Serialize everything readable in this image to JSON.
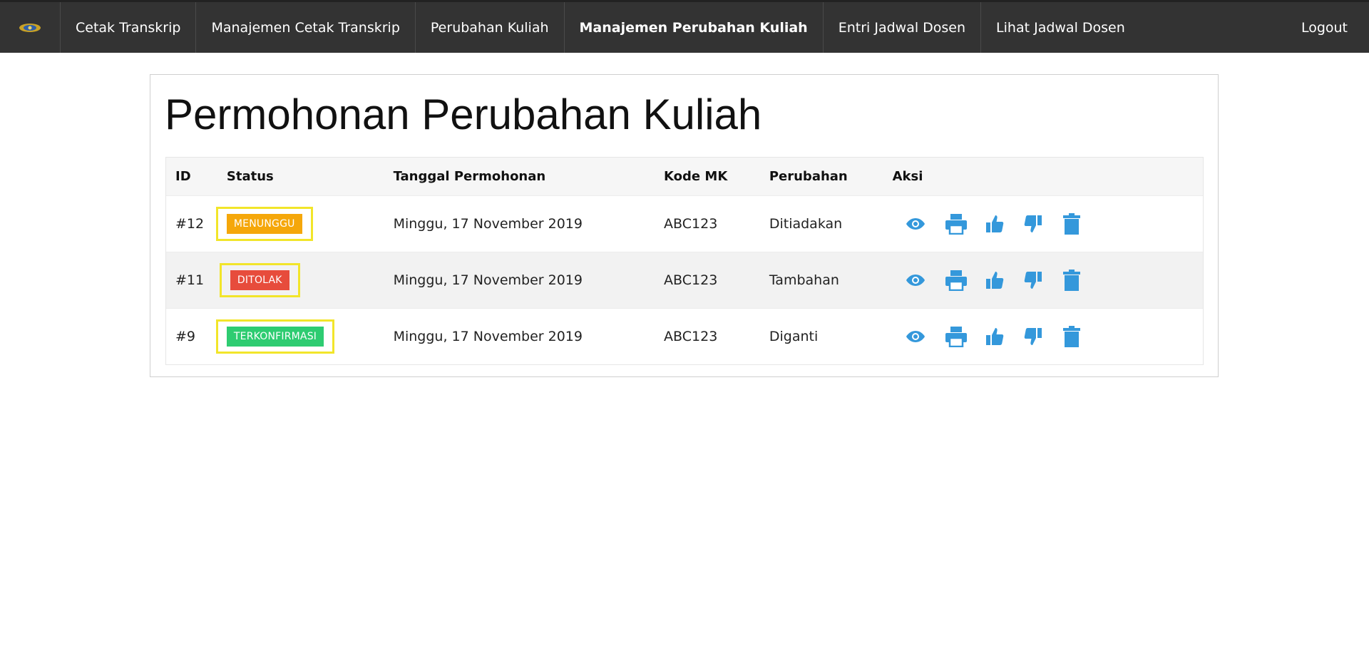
{
  "nav": {
    "items": [
      {
        "label": "Cetak Transkrip",
        "active": false
      },
      {
        "label": "Manajemen Cetak Transkrip",
        "active": false
      },
      {
        "label": "Perubahan Kuliah",
        "active": false
      },
      {
        "label": "Manajemen Perubahan Kuliah",
        "active": true
      },
      {
        "label": "Entri Jadwal Dosen",
        "active": false
      },
      {
        "label": "Lihat Jadwal Dosen",
        "active": false
      }
    ],
    "logout": "Logout"
  },
  "page": {
    "title": "Permohonan Perubahan Kuliah"
  },
  "table": {
    "headers": {
      "id": "ID",
      "status": "Status",
      "tanggal": "Tanggal Permohonan",
      "kode": "Kode MK",
      "perubahan": "Perubahan",
      "aksi": "Aksi"
    },
    "rows": [
      {
        "id": "#12",
        "status": "MENUNGGU",
        "status_color": "#f5a70a",
        "tanggal": "Minggu, 17 November 2019",
        "kode": "ABC123",
        "perubahan": "Ditiadakan"
      },
      {
        "id": "#11",
        "status": "DITOLAK",
        "status_color": "#e74c3c",
        "tanggal": "Minggu, 17 November 2019",
        "kode": "ABC123",
        "perubahan": "Tambahan"
      },
      {
        "id": "#9",
        "status": "TERKONFIRMASI",
        "status_color": "#2ecc71",
        "tanggal": "Minggu, 17 November 2019",
        "kode": "ABC123",
        "perubahan": "Diganti"
      }
    ],
    "actions": [
      "eye-icon",
      "printer-icon",
      "thumbs-up-icon",
      "thumbs-down-icon",
      "trash-icon"
    ]
  },
  "colors": {
    "navbar": "#333333",
    "action_icon": "#3498db",
    "highlight": "#f2e52a"
  }
}
